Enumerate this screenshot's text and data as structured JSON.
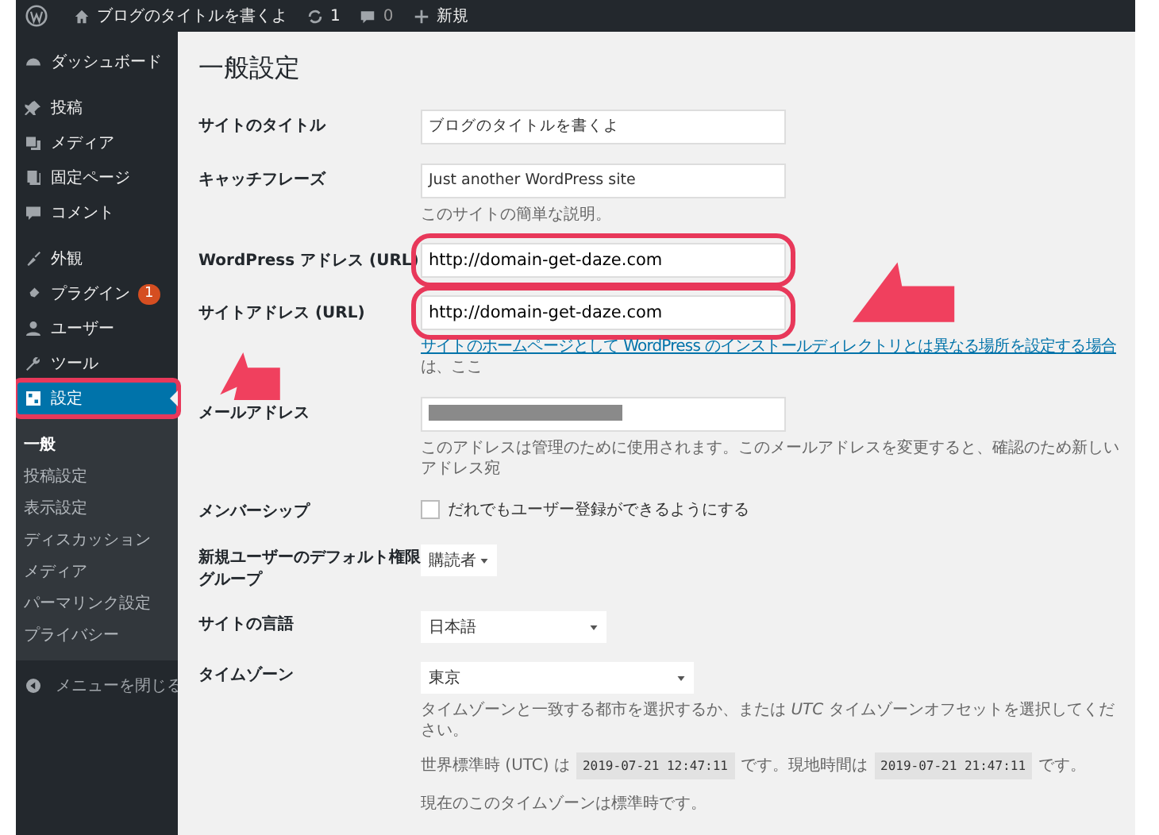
{
  "admin_bar": {
    "site_name": "ブログのタイトルを書くよ",
    "updates": "1",
    "comments": "0",
    "new": "新規"
  },
  "sidebar": {
    "items": [
      {
        "label": "ダッシュボード",
        "selected": false,
        "highlighted": false
      },
      {
        "label": "投稿",
        "selected": false,
        "highlighted": false
      },
      {
        "label": "メディア",
        "selected": false,
        "highlighted": false
      },
      {
        "label": "固定ページ",
        "selected": false,
        "highlighted": false
      },
      {
        "label": "コメント",
        "selected": false,
        "highlighted": false
      },
      {
        "label": "外観",
        "selected": false,
        "highlighted": false
      },
      {
        "label": "プラグイン",
        "selected": false,
        "highlighted": false,
        "badge": "1"
      },
      {
        "label": "ユーザー",
        "selected": false,
        "highlighted": false
      },
      {
        "label": "ツール",
        "selected": false,
        "highlighted": false
      },
      {
        "label": "設定",
        "selected": true,
        "highlighted": true
      }
    ],
    "submenu": [
      {
        "label": "一般",
        "selected": true
      },
      {
        "label": "投稿設定",
        "selected": false
      },
      {
        "label": "表示設定",
        "selected": false
      },
      {
        "label": "ディスカッション",
        "selected": false
      },
      {
        "label": "メディア",
        "selected": false
      },
      {
        "label": "パーマリンク設定",
        "selected": false
      },
      {
        "label": "プライバシー",
        "selected": false
      }
    ],
    "collapse": "メニューを閉じる"
  },
  "page": {
    "title": "一般設定",
    "rows": [
      {
        "kind": "text",
        "label": "サイトのタイトル",
        "value": "ブログのタイトルを書くよ",
        "highlighted": false
      },
      {
        "kind": "text",
        "label": "キャッチフレーズ",
        "value": "Just another WordPress site",
        "help": "このサイトの簡単な説明。",
        "highlighted": false
      },
      {
        "kind": "text",
        "label": "WordPress アドレス (URL)",
        "value": "http://domain-get-daze.com",
        "highlighted": true
      },
      {
        "kind": "text",
        "label": "サイトアドレス (URL)",
        "value": "http://domain-get-daze.com",
        "highlighted": true,
        "link": "サイトのホームページとして WordPress のインストールディレクトリとは異なる場所を設定する場合",
        "link_suffix": "は、ここ"
      },
      {
        "kind": "redacted",
        "label": "メールアドレス",
        "help": "このアドレスは管理のために使用されます。このメールアドレスを変更すると、確認のため新しいアドレス宛",
        "highlighted": false
      },
      {
        "kind": "checkbox",
        "label": "メンバーシップ",
        "text": "だれでもユーザー登録ができるようにする",
        "checked": false,
        "highlighted": false
      },
      {
        "kind": "select",
        "label": "新規ユーザーのデフォルト権限グループ",
        "value": "購読者",
        "highlighted": false
      },
      {
        "kind": "select",
        "label": "サイトの言語",
        "value": "日本語",
        "highlighted": false
      },
      {
        "kind": "timezone",
        "label": "タイムゾーン",
        "value": "東京",
        "help": "タイムゾーンと一致する都市を選択するか、または *UTC* タイムゾーンオフセットを選択してください。",
        "utc_prefix": "世界標準時 (UTC) は",
        "utc_time": "2019-07-21 12:47:11",
        "utc_suffix": "です。現地時間は",
        "local_time": "2019-07-21 21:47:11",
        "local_suffix": "です。",
        "note": "現在のこのタイムゾーンは標準時です。",
        "highlighted": false
      }
    ]
  }
}
